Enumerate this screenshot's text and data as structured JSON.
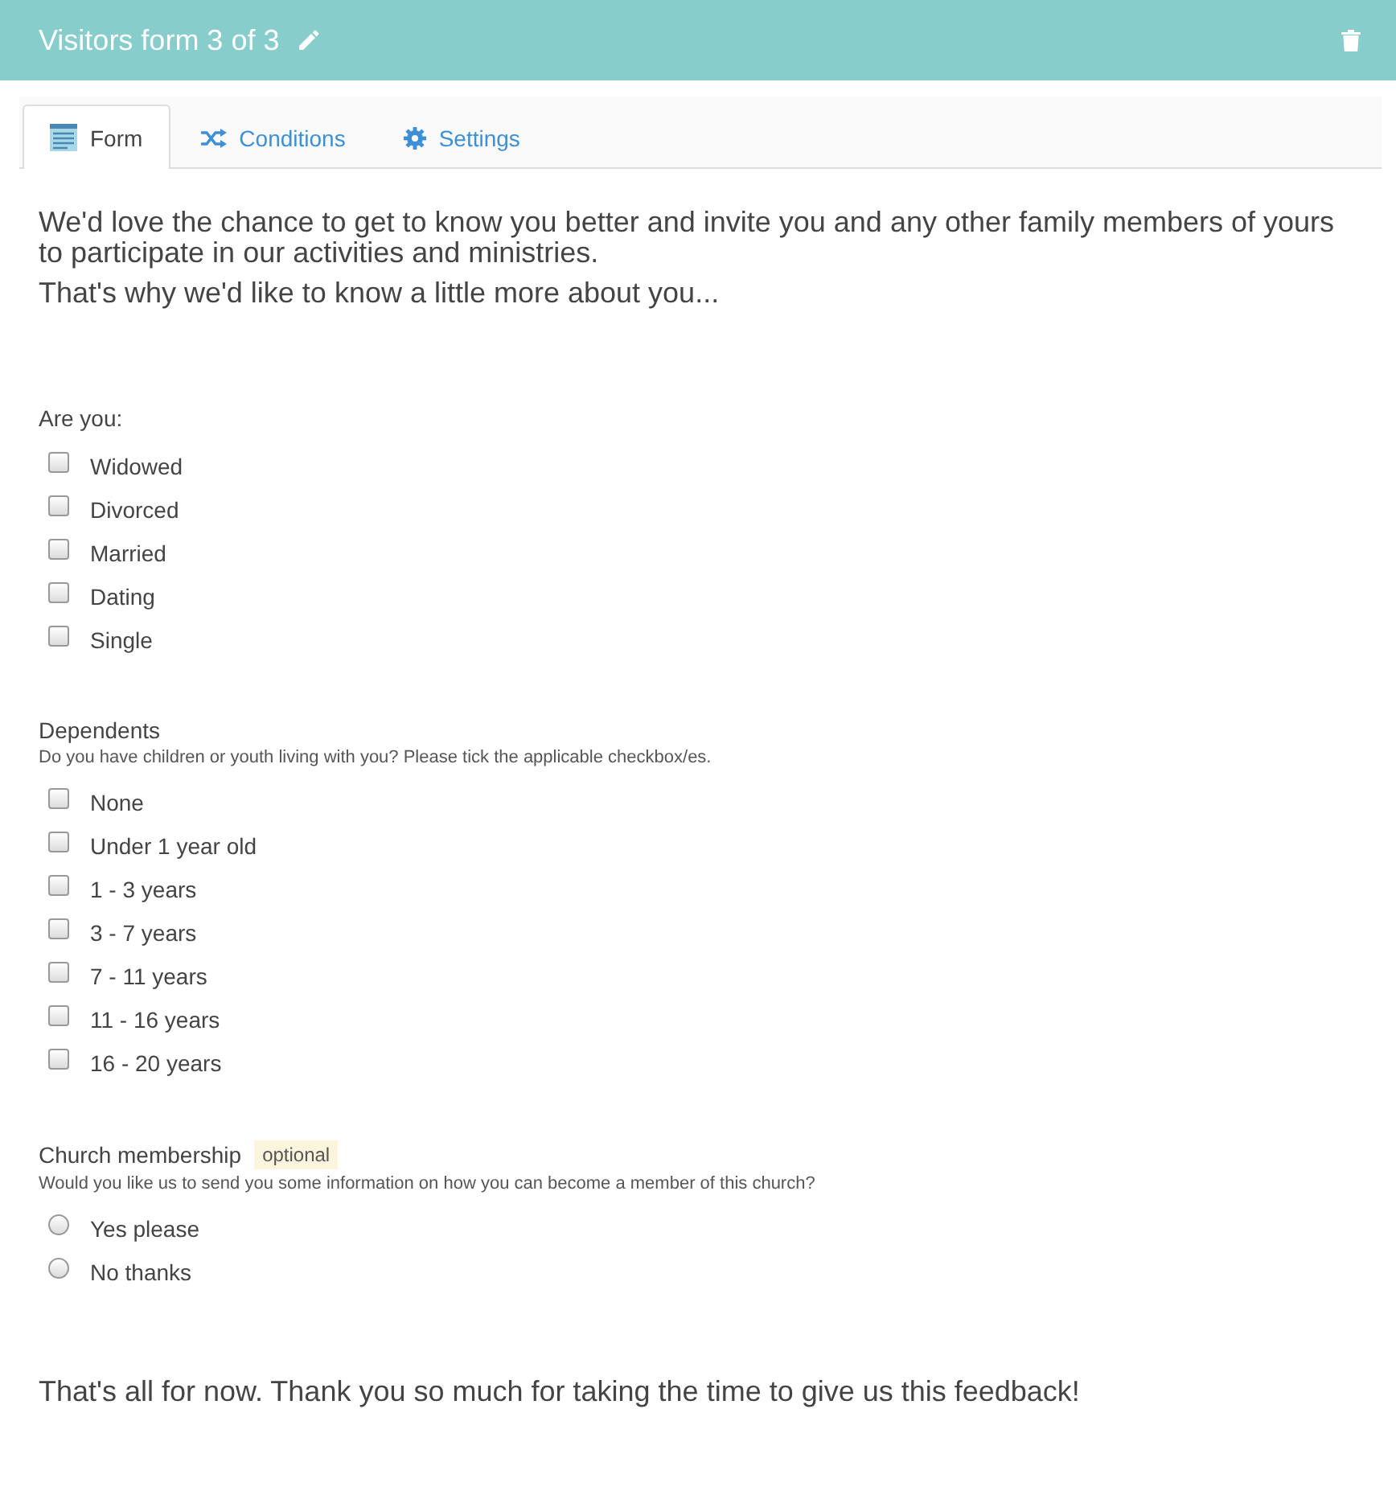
{
  "header": {
    "title": "Visitors form 3 of 3"
  },
  "tabs": [
    {
      "label": "Form",
      "selected": true
    },
    {
      "label": "Conditions",
      "selected": false
    },
    {
      "label": "Settings",
      "selected": false
    }
  ],
  "intro": [
    "We'd love the chance to get to know you better and invite you and any other family members of yours to participate in our activities and ministries.",
    "That's why we'd like to know a little more about you..."
  ],
  "questions": [
    {
      "kind": "checkbox",
      "label": "Are you:",
      "options": [
        {
          "label": "Widowed",
          "checked": false
        },
        {
          "label": "Divorced",
          "checked": false
        },
        {
          "label": "Married",
          "checked": false
        },
        {
          "label": "Dating",
          "checked": false
        },
        {
          "label": "Single",
          "checked": false
        }
      ]
    },
    {
      "kind": "checkbox",
      "label": "Dependents",
      "help": "Do you have children or youth living with you? Please tick the applicable checkbox/es.",
      "options": [
        {
          "label": "None",
          "checked": false
        },
        {
          "label": "Under 1 year old",
          "checked": false
        },
        {
          "label": "1 - 3 years",
          "checked": false
        },
        {
          "label": "3 - 7 years",
          "checked": false
        },
        {
          "label": "7 - 11 years",
          "checked": false
        },
        {
          "label": "11 - 16 years",
          "checked": false
        },
        {
          "label": "16 - 20 years",
          "checked": false
        }
      ]
    },
    {
      "kind": "radio",
      "label": "Church membership",
      "badge": "optional",
      "help": "Would you like us to send you some information on how you can become a member of this church?",
      "options": [
        {
          "label": "Yes please",
          "selected": false
        },
        {
          "label": "No thanks",
          "selected": false
        }
      ]
    }
  ],
  "closing": "That's all for now. Thank you so much for taking the time to give us this feedback!"
}
